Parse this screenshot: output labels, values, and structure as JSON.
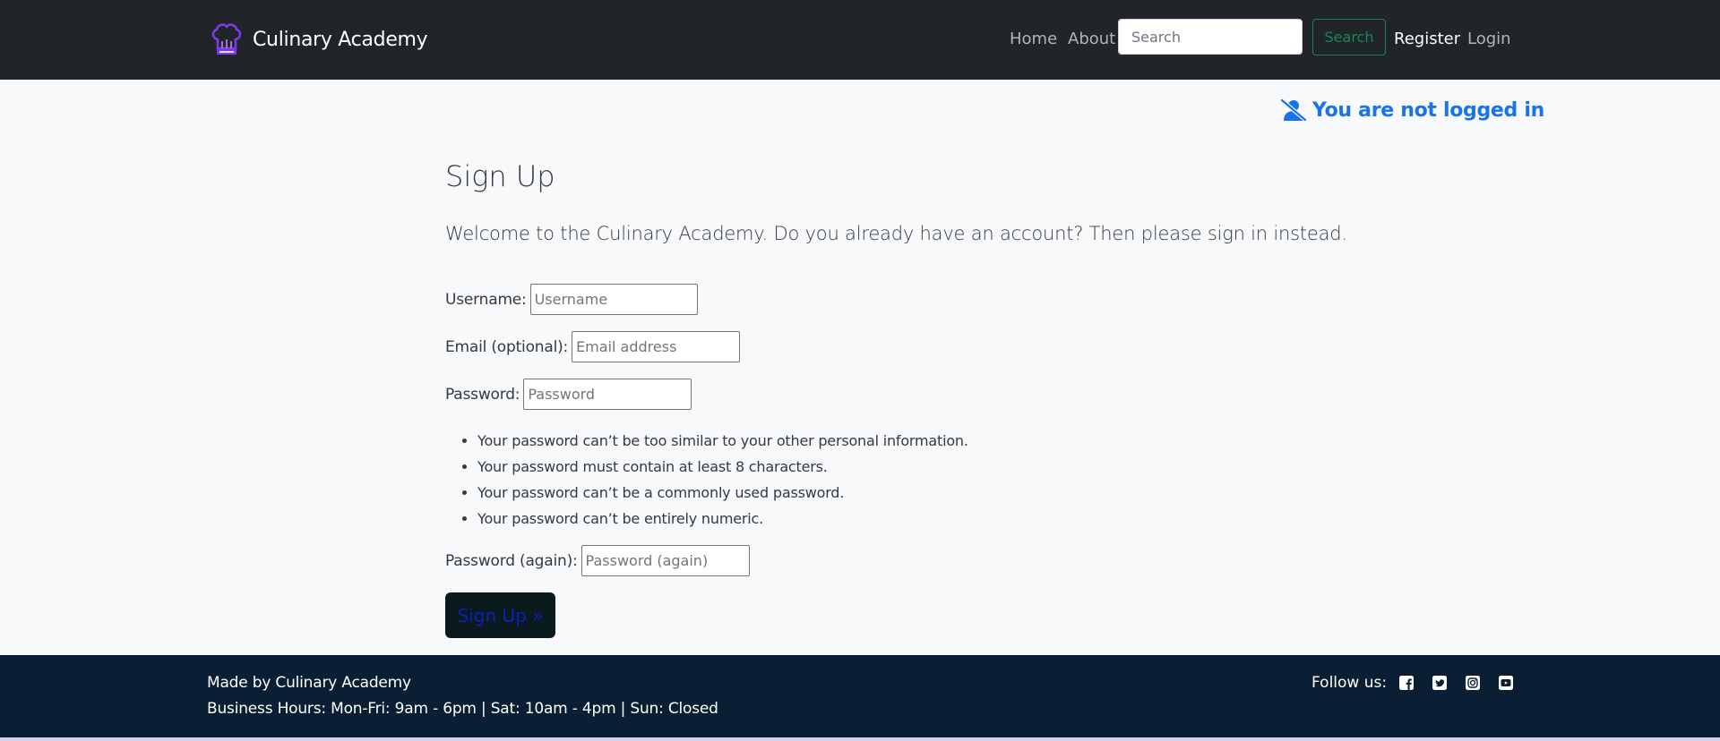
{
  "navbar": {
    "brand": "Culinary Academy",
    "links": {
      "home": "Home",
      "about": "About",
      "register": "Register",
      "login": "Login"
    },
    "search": {
      "placeholder": "Search",
      "button": "Search"
    },
    "brand_icon": "chef-hat-icon"
  },
  "auth_status": {
    "text": "You are not logged in",
    "icon": "user-slash-icon",
    "color": "#1a73e8"
  },
  "main": {
    "title": "Sign Up",
    "intro_before": "Welcome to the Culinary Academy. Do you already have an account? Then please ",
    "intro_link": "sign in",
    "intro_after": " instead.",
    "fields": {
      "username": {
        "label": "Username:",
        "placeholder": "Username"
      },
      "email": {
        "label": "Email (optional):",
        "placeholder": "Email address"
      },
      "password": {
        "label": "Password:",
        "placeholder": "Password"
      },
      "password2": {
        "label": "Password (again):",
        "placeholder": "Password (again)"
      }
    },
    "password_help": [
      "Your password can’t be too similar to your other personal information.",
      "Your password must contain at least 8 characters.",
      "Your password can’t be a commonly used password.",
      "Your password can’t be entirely numeric."
    ],
    "submit": "Sign Up »"
  },
  "footer": {
    "made_by": "Made by Culinary Academy",
    "hours": "Business Hours: Mon-Fri: 9am - 6pm | Sat: 10am - 4pm | Sun: Closed",
    "follow": "Follow us:",
    "social_icons": [
      "facebook-icon",
      "twitter-icon",
      "instagram-icon",
      "youtube-icon"
    ]
  },
  "colors": {
    "navbar_bg": "#212529",
    "page_bg": "#f8f9fa",
    "footer_bg": "#0a1f33",
    "search_button": "#198754",
    "brand_icon": "#7c3aed"
  }
}
